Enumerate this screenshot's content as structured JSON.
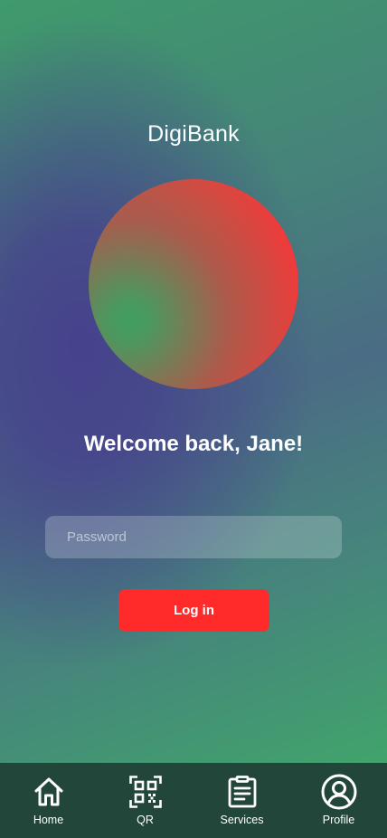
{
  "app": {
    "title": "DigiBank"
  },
  "login": {
    "welcome_text": "Welcome back, Jane!",
    "password_placeholder": "Password",
    "login_label": "Log in"
  },
  "nav": {
    "items": [
      {
        "label": "Home",
        "icon": "home-icon"
      },
      {
        "label": "QR",
        "icon": "qr-code-icon"
      },
      {
        "label": "Services",
        "icon": "clipboard-icon"
      },
      {
        "label": "Profile",
        "icon": "user-circle-icon"
      }
    ]
  },
  "colors": {
    "primary_button": "#ff2a2a",
    "tab_bar": "#23463a",
    "text": "#ffffff"
  }
}
